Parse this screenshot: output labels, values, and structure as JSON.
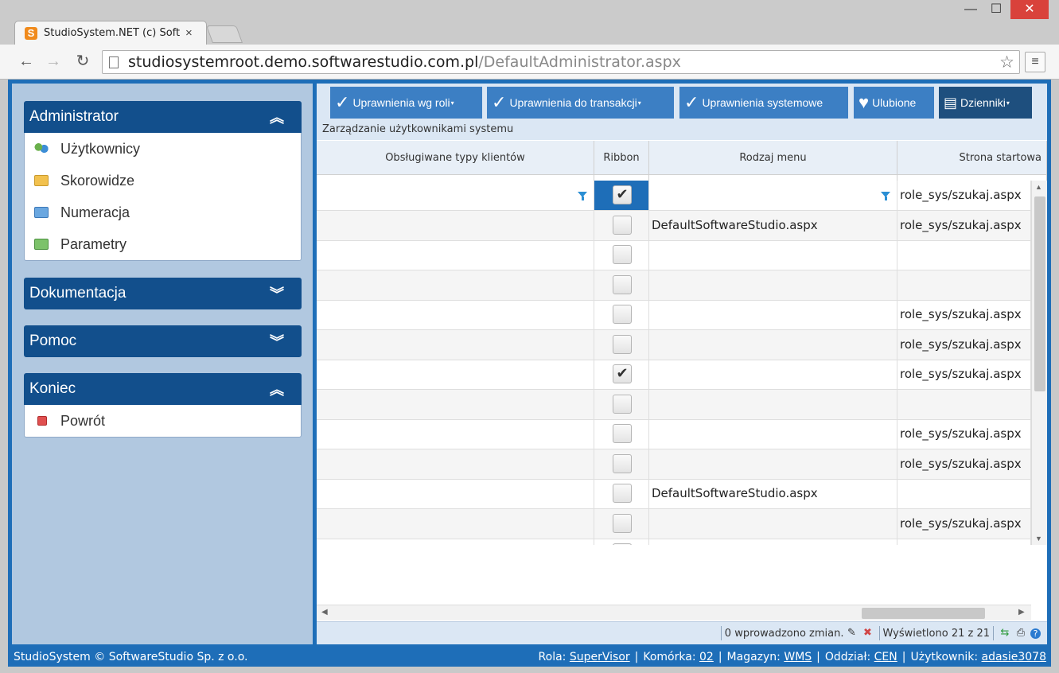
{
  "browser": {
    "tab_title": "StudioSystem.NET (c) Soft",
    "tab_close": "×",
    "favicon_letter": "S",
    "url_host": "studiosystemroot.demo.softwarestudio.com.pl",
    "url_path": "/DefaultAdministrator.aspx",
    "window_min": "—",
    "window_max": "☐",
    "window_close": "✕",
    "back": "←",
    "forward": "→",
    "reload": "↻",
    "star": "☆",
    "menu": "≡"
  },
  "sidebar": {
    "panels": [
      {
        "title": "Administrator",
        "chevron": "︽",
        "items": [
          {
            "label": "Użytkownicy",
            "icon": "users-icon"
          },
          {
            "label": "Skorowidze",
            "icon": "folder-icon"
          },
          {
            "label": "Numeracja",
            "icon": "folder-icon"
          },
          {
            "label": "Parametry",
            "icon": "folder-icon"
          }
        ]
      },
      {
        "title": "Dokumentacja",
        "chevron": "︾"
      },
      {
        "title": "Pomoc",
        "chevron": "︾"
      },
      {
        "title": "Koniec",
        "chevron": "︽",
        "items": [
          {
            "label": "Powrót",
            "icon": "stop-icon"
          }
        ]
      }
    ]
  },
  "toolbar": {
    "buttons": [
      {
        "label": "Uprawnienia wg roli",
        "icon": "✓",
        "caret": "▾"
      },
      {
        "label": "Uprawnienia do transakcji",
        "icon": "✓",
        "caret": "▾"
      },
      {
        "label": "Uprawnienia systemowe",
        "icon": "✓"
      },
      {
        "label": "Ulubione",
        "icon": "♥"
      },
      {
        "label": "Dzienniki",
        "icon": "▤",
        "caret": "▾"
      }
    ]
  },
  "subtitle": "Zarządzanie użytkownikami systemu",
  "grid": {
    "columns": [
      "Obsługiwane typy klientów",
      "Ribbon",
      "Rodzaj menu",
      "Strona startowa"
    ],
    "rows": [
      {
        "types": "",
        "ribbon": "✔",
        "menu": "",
        "start": "role_sys/szukaj.aspx",
        "selected": true
      },
      {
        "types": "",
        "ribbon": "",
        "menu": "DefaultSoftwareStudio.aspx",
        "start": "role_sys/szukaj.aspx"
      },
      {
        "types": "",
        "ribbon": "",
        "menu": "",
        "start": ""
      },
      {
        "types": "",
        "ribbon": "",
        "menu": "",
        "start": ""
      },
      {
        "types": "",
        "ribbon": "",
        "menu": "",
        "start": "role_sys/szukaj.aspx"
      },
      {
        "types": "",
        "ribbon": "",
        "menu": "",
        "start": "role_sys/szukaj.aspx"
      },
      {
        "types": "",
        "ribbon": "✔",
        "menu": "",
        "start": "role_sys/szukaj.aspx"
      },
      {
        "types": "",
        "ribbon": "",
        "menu": "",
        "start": ""
      },
      {
        "types": "",
        "ribbon": "",
        "menu": "",
        "start": "role_sys/szukaj.aspx"
      },
      {
        "types": "",
        "ribbon": "",
        "menu": "",
        "start": "role_sys/szukaj.aspx"
      },
      {
        "types": "",
        "ribbon": "",
        "menu": "DefaultSoftwareStudio.aspx",
        "start": ""
      },
      {
        "types": "",
        "ribbon": "",
        "menu": "",
        "start": "role_sys/szukaj.aspx"
      },
      {
        "types": "",
        "ribbon": "",
        "menu": "",
        "start": ""
      }
    ]
  },
  "status": {
    "changes": "0 wprowadzono zmian.",
    "shown": "Wyświetlono 21 z 21"
  },
  "footer": {
    "copyright": "StudioSystem © SoftwareStudio Sp. z o.o.",
    "role_label": "Rola:",
    "role_value": "SuperVisor",
    "cell_label": "Komórka:",
    "cell_value": "02",
    "store_label": "Magazyn:",
    "store_value": "WMS",
    "branch_label": "Oddział:",
    "branch_value": "CEN",
    "user_label": "Użytkownik:",
    "user_value": "adasie3078",
    "separator": "|"
  },
  "colors": {
    "app_blue": "#1e6eb8",
    "panel_head": "#124f8c",
    "sidebar_bg": "#b1c8e0",
    "button_blue": "#3c7fc4",
    "group_bar": "#fce39c"
  }
}
